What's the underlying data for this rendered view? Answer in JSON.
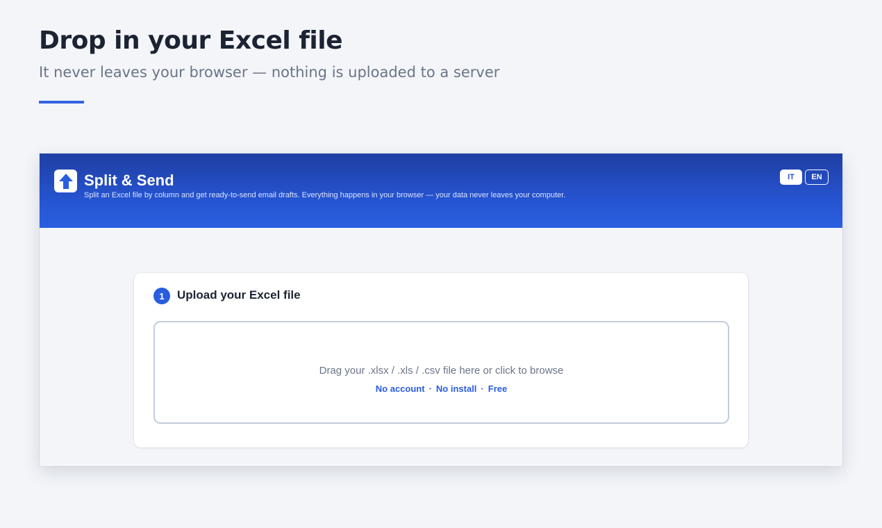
{
  "hero": {
    "title": "Drop in your Excel file",
    "subtitle": "It never leaves your browser — nothing is uploaded to a server"
  },
  "app": {
    "title": "Split & Send",
    "tagline": "Split an Excel file by column and get ready-to-send email drafts. Everything happens in your browser — your data never leaves your computer.",
    "logo_icon": "upload-arrow-icon",
    "languages": [
      {
        "code": "IT",
        "active": true
      },
      {
        "code": "EN",
        "active": false
      }
    ]
  },
  "upload_step": {
    "number": "1",
    "title": "Upload your Excel file",
    "dropzone_text": "Drag your .xlsx / .xls / .csv file here or click to browse",
    "features": [
      "No account",
      "No install",
      "Free"
    ],
    "separator": "·"
  },
  "colors": {
    "accent": "#2a5ce0",
    "header_gradient_top": "#1f3fa3",
    "header_gradient_bottom": "#2a5fe0",
    "background": "#f3f5f9"
  }
}
